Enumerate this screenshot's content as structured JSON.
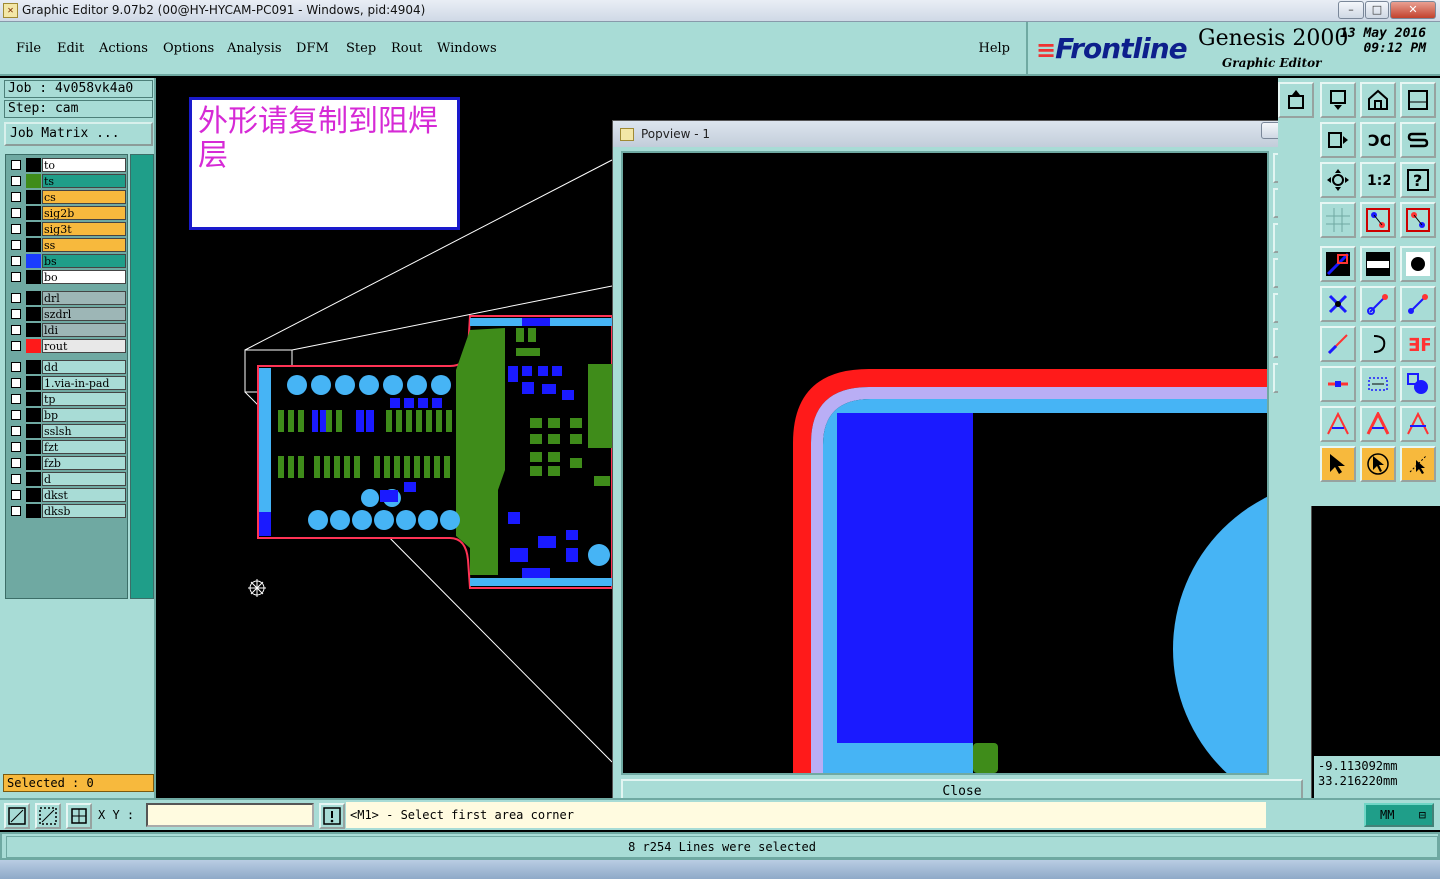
{
  "window": {
    "title": "Graphic Editor 9.07b2 (00@HY-HYCAM-PC091 - Windows, pid:4904)",
    "minimize": "–",
    "maximize": "□",
    "close": "✕"
  },
  "menu": {
    "items": [
      "File",
      "Edit",
      "Actions",
      "Options",
      "Analysis",
      "DFM",
      "Step",
      "Rout",
      "Windows"
    ],
    "help": "Help"
  },
  "brand": {
    "logo": "Frontline",
    "product": "Genesis 2000",
    "subtitle": "Graphic Editor",
    "date": "13 May 2016",
    "time": "09:12 PM"
  },
  "left": {
    "job": "Job : 4v058vk4a0",
    "step": "Step: cam",
    "job_matrix": "Job Matrix ...",
    "selected": "Selected : 0",
    "layers": [
      {
        "name": "to",
        "swatch": "#000000",
        "bg": "#ffffff"
      },
      {
        "name": "ts",
        "swatch": "#3f8c1a",
        "bg": "#1f9e89"
      },
      {
        "name": "cs",
        "swatch": "#000000",
        "bg": "#f7b93d"
      },
      {
        "name": "sig2b",
        "swatch": "#000000",
        "bg": "#f7b93d"
      },
      {
        "name": "sig3t",
        "swatch": "#000000",
        "bg": "#f7b93d"
      },
      {
        "name": "ss",
        "swatch": "#000000",
        "bg": "#f7b93d"
      },
      {
        "name": "bs",
        "swatch": "#1a3cff",
        "bg": "#1f9e89"
      },
      {
        "name": "bo",
        "swatch": "#000000",
        "bg": "#ffffff"
      },
      {
        "name": "drl",
        "swatch": "#000000",
        "bg": "#9db6b6"
      },
      {
        "name": "szdrl",
        "swatch": "#000000",
        "bg": "#9db6b6"
      },
      {
        "name": "ldi",
        "swatch": "#000000",
        "bg": "#9db6b6"
      },
      {
        "name": "rout",
        "swatch": "#ff1a1a",
        "bg": "#e8e8e8"
      },
      {
        "name": "dd",
        "swatch": "#000000",
        "bg": "#a8dcd6"
      },
      {
        "name": "1.via-in-pad",
        "swatch": "#000000",
        "bg": "#a8dcd6"
      },
      {
        "name": "tp",
        "swatch": "#000000",
        "bg": "#a8dcd6"
      },
      {
        "name": "bp",
        "swatch": "#000000",
        "bg": "#a8dcd6"
      },
      {
        "name": "sslsh",
        "swatch": "#000000",
        "bg": "#a8dcd6"
      },
      {
        "name": "fzt",
        "swatch": "#000000",
        "bg": "#a8dcd6"
      },
      {
        "name": "fzb",
        "swatch": "#000000",
        "bg": "#a8dcd6"
      },
      {
        "name": "d",
        "swatch": "#000000",
        "bg": "#a8dcd6"
      },
      {
        "name": "dkst",
        "swatch": "#000000",
        "bg": "#a8dcd6"
      },
      {
        "name": "dksb",
        "swatch": "#000000",
        "bg": "#a8dcd6"
      }
    ]
  },
  "note": {
    "text": "外形请复制到阻焊层"
  },
  "popview": {
    "title": "Popview - 1",
    "close_x": "✕",
    "close_button": "Close"
  },
  "coords": {
    "x": "-9.113092mm",
    "y": "33.216220mm"
  },
  "bottom": {
    "xy_label": "X Y :",
    "xy_value": "",
    "prompt": "<M1> - Select first area corner",
    "units": "MM",
    "status": "8 r254 Lines were selected"
  },
  "colors": {
    "panel": "#a8dcd6",
    "accent_teal": "#1f9e89",
    "orange": "#f7b93d",
    "rout_red": "#ff1a1a",
    "pad_blue": "#46b4f5",
    "copper_green": "#3f8c1a",
    "mask_blue": "#1a1aff"
  }
}
